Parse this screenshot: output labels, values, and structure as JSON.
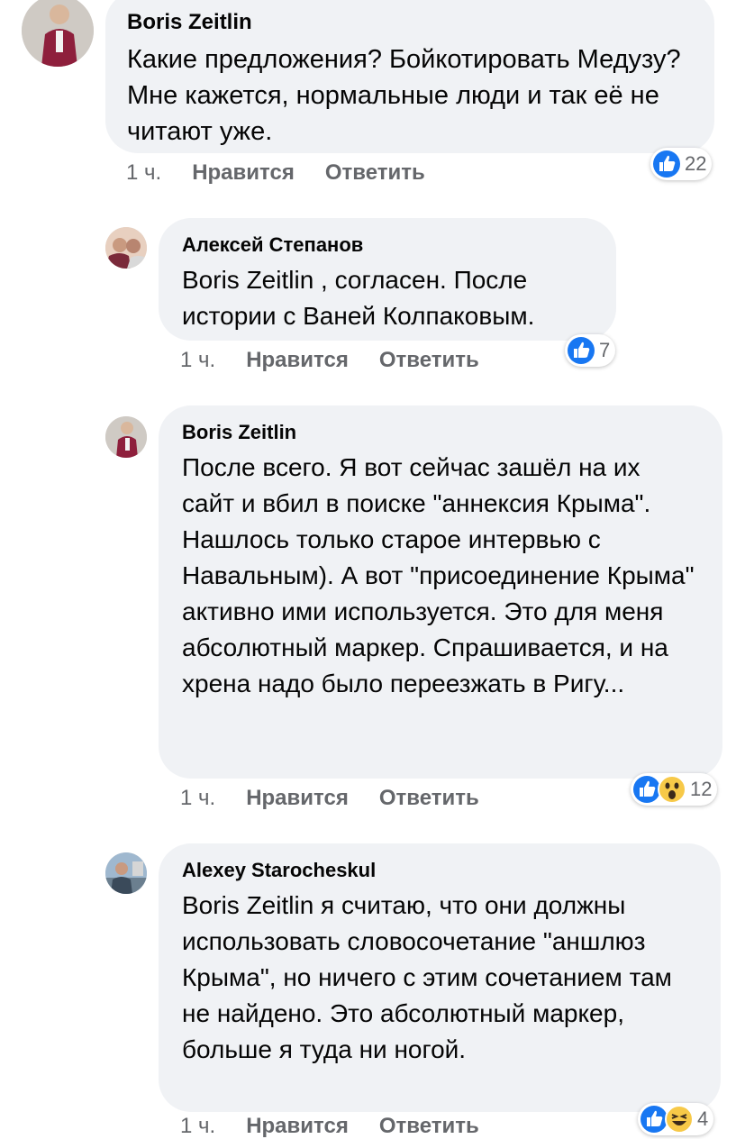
{
  "comments": [
    {
      "author": "Boris Zeitlin",
      "text": "Какие предложения? Бойкотировать Медузу? Мне кажется, нормальные люди и так её не читают уже.",
      "time": "1 ч.",
      "like_label": "Нравится",
      "reply_label": "Ответить",
      "reactions": [
        "like"
      ],
      "reaction_count": "22"
    },
    {
      "author": "Алексей Степанов",
      "text": "Boris Zeitlin , согласен. После истории с Ваней Колпаковым.",
      "time": "1 ч.",
      "like_label": "Нравится",
      "reply_label": "Ответить",
      "reactions": [
        "like"
      ],
      "reaction_count": "7"
    },
    {
      "author": "Boris Zeitlin",
      "text": "После всего. Я вот сейчас зашёл на их сайт и вбил в поиске \"аннексия Крыма\". Нашлось только старое интервью с Навальным). А вот \"присоединение Крыма\" активно ими используется. Это для меня абсолютный маркер. Спрашивается, и на хрена надо было переезжать в Ригу...",
      "time": "1 ч.",
      "like_label": "Нравится",
      "reply_label": "Ответить",
      "reactions": [
        "like",
        "wow"
      ],
      "reaction_count": "12"
    },
    {
      "author": "Alexey Starocheskul",
      "text": "Boris Zeitlin я считаю, что они должны использовать словосочетание \"аншлюз Крыма\", но ничего с этим сочетанием там не найдено. Это абсолютный маркер, больше я туда ни ногой.",
      "time": "1 ч.",
      "like_label": "Нравится",
      "reply_label": "Ответить",
      "reactions": [
        "like",
        "haha"
      ],
      "reaction_count": "4"
    }
  ],
  "colors": {
    "bubble": "#f0f2f5",
    "meta_text": "#65676b",
    "like_blue": "#1877f2",
    "emoji_yellow": "#f7c948"
  }
}
